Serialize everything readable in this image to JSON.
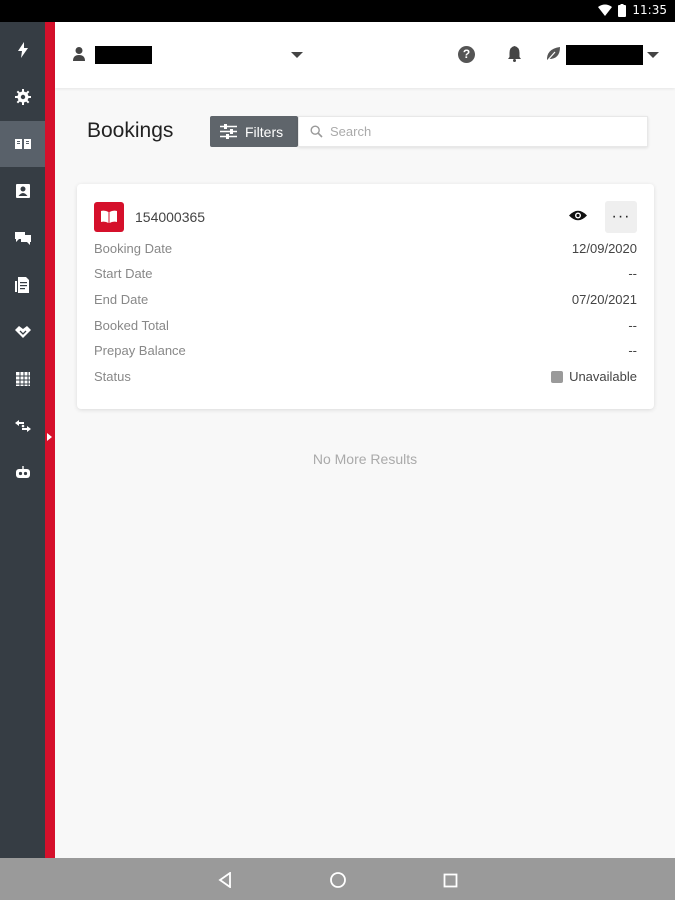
{
  "status_bar": {
    "time": "11:35"
  },
  "sidebar": {
    "items": [
      {
        "icon": "lightning-icon"
      },
      {
        "icon": "gear-icon"
      },
      {
        "icon": "book-open-icon",
        "active": true
      },
      {
        "icon": "guest-card-icon"
      },
      {
        "icon": "chat-icon"
      },
      {
        "icon": "document-icon"
      },
      {
        "icon": "handshake-icon"
      },
      {
        "icon": "calendar-grid-icon"
      },
      {
        "icon": "exchange-icon"
      },
      {
        "icon": "robot-icon"
      }
    ]
  },
  "header": {
    "account_name": "",
    "user_name": ""
  },
  "page": {
    "title": "Bookings",
    "filters_label": "Filters",
    "search_placeholder": "Search"
  },
  "booking": {
    "id": "154000365",
    "fields": [
      {
        "label": "Booking Date",
        "value": "12/09/2020"
      },
      {
        "label": "Start Date",
        "value": "--"
      },
      {
        "label": "End Date",
        "value": "07/20/2021"
      },
      {
        "label": "Booked Total",
        "value": "--"
      },
      {
        "label": "Prepay Balance",
        "value": "--"
      },
      {
        "label": "Status",
        "value": "Unavailable"
      }
    ],
    "status_color": "#9a9a9a",
    "more_label": "···"
  },
  "results": {
    "end_message": "No More Results"
  },
  "colors": {
    "accent": "#d5102b",
    "rail": "#363d44"
  }
}
